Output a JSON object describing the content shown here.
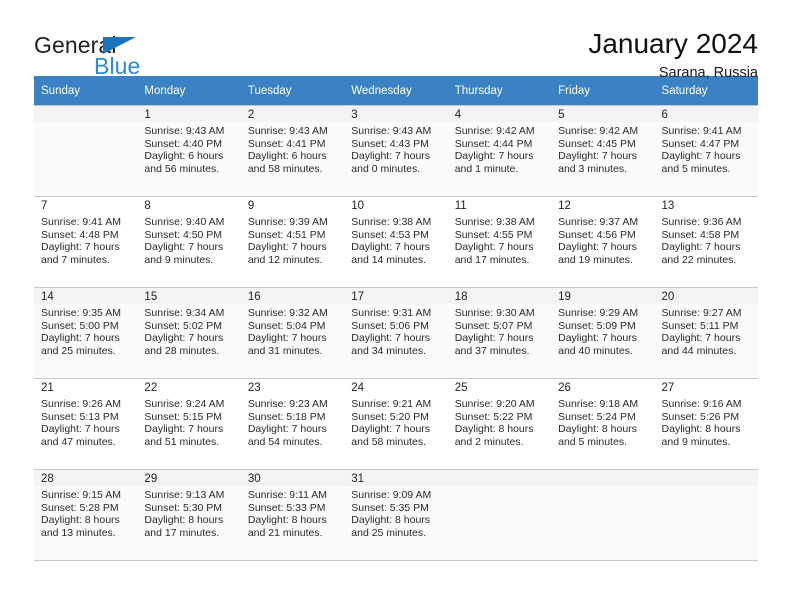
{
  "brand": {
    "word1": "General",
    "word2": "Blue",
    "flag_icon": "triangle-flag-icon",
    "accent_color": "#1a76bc"
  },
  "header": {
    "title": "January 2024",
    "location": "Sarana, Russia"
  },
  "calendar": {
    "header_bg": "#3b82c4",
    "weekdays": [
      "Sunday",
      "Monday",
      "Tuesday",
      "Wednesday",
      "Thursday",
      "Friday",
      "Saturday"
    ],
    "weeks": [
      [
        {
          "day": "",
          "sunrise": "",
          "sunset": "",
          "daylight1": "",
          "daylight2": ""
        },
        {
          "day": "1",
          "sunrise": "Sunrise: 9:43 AM",
          "sunset": "Sunset: 4:40 PM",
          "daylight1": "Daylight: 6 hours",
          "daylight2": "and 56 minutes."
        },
        {
          "day": "2",
          "sunrise": "Sunrise: 9:43 AM",
          "sunset": "Sunset: 4:41 PM",
          "daylight1": "Daylight: 6 hours",
          "daylight2": "and 58 minutes."
        },
        {
          "day": "3",
          "sunrise": "Sunrise: 9:43 AM",
          "sunset": "Sunset: 4:43 PM",
          "daylight1": "Daylight: 7 hours",
          "daylight2": "and 0 minutes."
        },
        {
          "day": "4",
          "sunrise": "Sunrise: 9:42 AM",
          "sunset": "Sunset: 4:44 PM",
          "daylight1": "Daylight: 7 hours",
          "daylight2": "and 1 minute."
        },
        {
          "day": "5",
          "sunrise": "Sunrise: 9:42 AM",
          "sunset": "Sunset: 4:45 PM",
          "daylight1": "Daylight: 7 hours",
          "daylight2": "and 3 minutes."
        },
        {
          "day": "6",
          "sunrise": "Sunrise: 9:41 AM",
          "sunset": "Sunset: 4:47 PM",
          "daylight1": "Daylight: 7 hours",
          "daylight2": "and 5 minutes."
        }
      ],
      [
        {
          "day": "7",
          "sunrise": "Sunrise: 9:41 AM",
          "sunset": "Sunset: 4:48 PM",
          "daylight1": "Daylight: 7 hours",
          "daylight2": "and 7 minutes."
        },
        {
          "day": "8",
          "sunrise": "Sunrise: 9:40 AM",
          "sunset": "Sunset: 4:50 PM",
          "daylight1": "Daylight: 7 hours",
          "daylight2": "and 9 minutes."
        },
        {
          "day": "9",
          "sunrise": "Sunrise: 9:39 AM",
          "sunset": "Sunset: 4:51 PM",
          "daylight1": "Daylight: 7 hours",
          "daylight2": "and 12 minutes."
        },
        {
          "day": "10",
          "sunrise": "Sunrise: 9:38 AM",
          "sunset": "Sunset: 4:53 PM",
          "daylight1": "Daylight: 7 hours",
          "daylight2": "and 14 minutes."
        },
        {
          "day": "11",
          "sunrise": "Sunrise: 9:38 AM",
          "sunset": "Sunset: 4:55 PM",
          "daylight1": "Daylight: 7 hours",
          "daylight2": "and 17 minutes."
        },
        {
          "day": "12",
          "sunrise": "Sunrise: 9:37 AM",
          "sunset": "Sunset: 4:56 PM",
          "daylight1": "Daylight: 7 hours",
          "daylight2": "and 19 minutes."
        },
        {
          "day": "13",
          "sunrise": "Sunrise: 9:36 AM",
          "sunset": "Sunset: 4:58 PM",
          "daylight1": "Daylight: 7 hours",
          "daylight2": "and 22 minutes."
        }
      ],
      [
        {
          "day": "14",
          "sunrise": "Sunrise: 9:35 AM",
          "sunset": "Sunset: 5:00 PM",
          "daylight1": "Daylight: 7 hours",
          "daylight2": "and 25 minutes."
        },
        {
          "day": "15",
          "sunrise": "Sunrise: 9:34 AM",
          "sunset": "Sunset: 5:02 PM",
          "daylight1": "Daylight: 7 hours",
          "daylight2": "and 28 minutes."
        },
        {
          "day": "16",
          "sunrise": "Sunrise: 9:32 AM",
          "sunset": "Sunset: 5:04 PM",
          "daylight1": "Daylight: 7 hours",
          "daylight2": "and 31 minutes."
        },
        {
          "day": "17",
          "sunrise": "Sunrise: 9:31 AM",
          "sunset": "Sunset: 5:06 PM",
          "daylight1": "Daylight: 7 hours",
          "daylight2": "and 34 minutes."
        },
        {
          "day": "18",
          "sunrise": "Sunrise: 9:30 AM",
          "sunset": "Sunset: 5:07 PM",
          "daylight1": "Daylight: 7 hours",
          "daylight2": "and 37 minutes."
        },
        {
          "day": "19",
          "sunrise": "Sunrise: 9:29 AM",
          "sunset": "Sunset: 5:09 PM",
          "daylight1": "Daylight: 7 hours",
          "daylight2": "and 40 minutes."
        },
        {
          "day": "20",
          "sunrise": "Sunrise: 9:27 AM",
          "sunset": "Sunset: 5:11 PM",
          "daylight1": "Daylight: 7 hours",
          "daylight2": "and 44 minutes."
        }
      ],
      [
        {
          "day": "21",
          "sunrise": "Sunrise: 9:26 AM",
          "sunset": "Sunset: 5:13 PM",
          "daylight1": "Daylight: 7 hours",
          "daylight2": "and 47 minutes."
        },
        {
          "day": "22",
          "sunrise": "Sunrise: 9:24 AM",
          "sunset": "Sunset: 5:15 PM",
          "daylight1": "Daylight: 7 hours",
          "daylight2": "and 51 minutes."
        },
        {
          "day": "23",
          "sunrise": "Sunrise: 9:23 AM",
          "sunset": "Sunset: 5:18 PM",
          "daylight1": "Daylight: 7 hours",
          "daylight2": "and 54 minutes."
        },
        {
          "day": "24",
          "sunrise": "Sunrise: 9:21 AM",
          "sunset": "Sunset: 5:20 PM",
          "daylight1": "Daylight: 7 hours",
          "daylight2": "and 58 minutes."
        },
        {
          "day": "25",
          "sunrise": "Sunrise: 9:20 AM",
          "sunset": "Sunset: 5:22 PM",
          "daylight1": "Daylight: 8 hours",
          "daylight2": "and 2 minutes."
        },
        {
          "day": "26",
          "sunrise": "Sunrise: 9:18 AM",
          "sunset": "Sunset: 5:24 PM",
          "daylight1": "Daylight: 8 hours",
          "daylight2": "and 5 minutes."
        },
        {
          "day": "27",
          "sunrise": "Sunrise: 9:16 AM",
          "sunset": "Sunset: 5:26 PM",
          "daylight1": "Daylight: 8 hours",
          "daylight2": "and 9 minutes."
        }
      ],
      [
        {
          "day": "28",
          "sunrise": "Sunrise: 9:15 AM",
          "sunset": "Sunset: 5:28 PM",
          "daylight1": "Daylight: 8 hours",
          "daylight2": "and 13 minutes."
        },
        {
          "day": "29",
          "sunrise": "Sunrise: 9:13 AM",
          "sunset": "Sunset: 5:30 PM",
          "daylight1": "Daylight: 8 hours",
          "daylight2": "and 17 minutes."
        },
        {
          "day": "30",
          "sunrise": "Sunrise: 9:11 AM",
          "sunset": "Sunset: 5:33 PM",
          "daylight1": "Daylight: 8 hours",
          "daylight2": "and 21 minutes."
        },
        {
          "day": "31",
          "sunrise": "Sunrise: 9:09 AM",
          "sunset": "Sunset: 5:35 PM",
          "daylight1": "Daylight: 8 hours",
          "daylight2": "and 25 minutes."
        },
        {
          "day": "",
          "sunrise": "",
          "sunset": "",
          "daylight1": "",
          "daylight2": ""
        },
        {
          "day": "",
          "sunrise": "",
          "sunset": "",
          "daylight1": "",
          "daylight2": ""
        },
        {
          "day": "",
          "sunrise": "",
          "sunset": "",
          "daylight1": "",
          "daylight2": ""
        }
      ]
    ]
  }
}
